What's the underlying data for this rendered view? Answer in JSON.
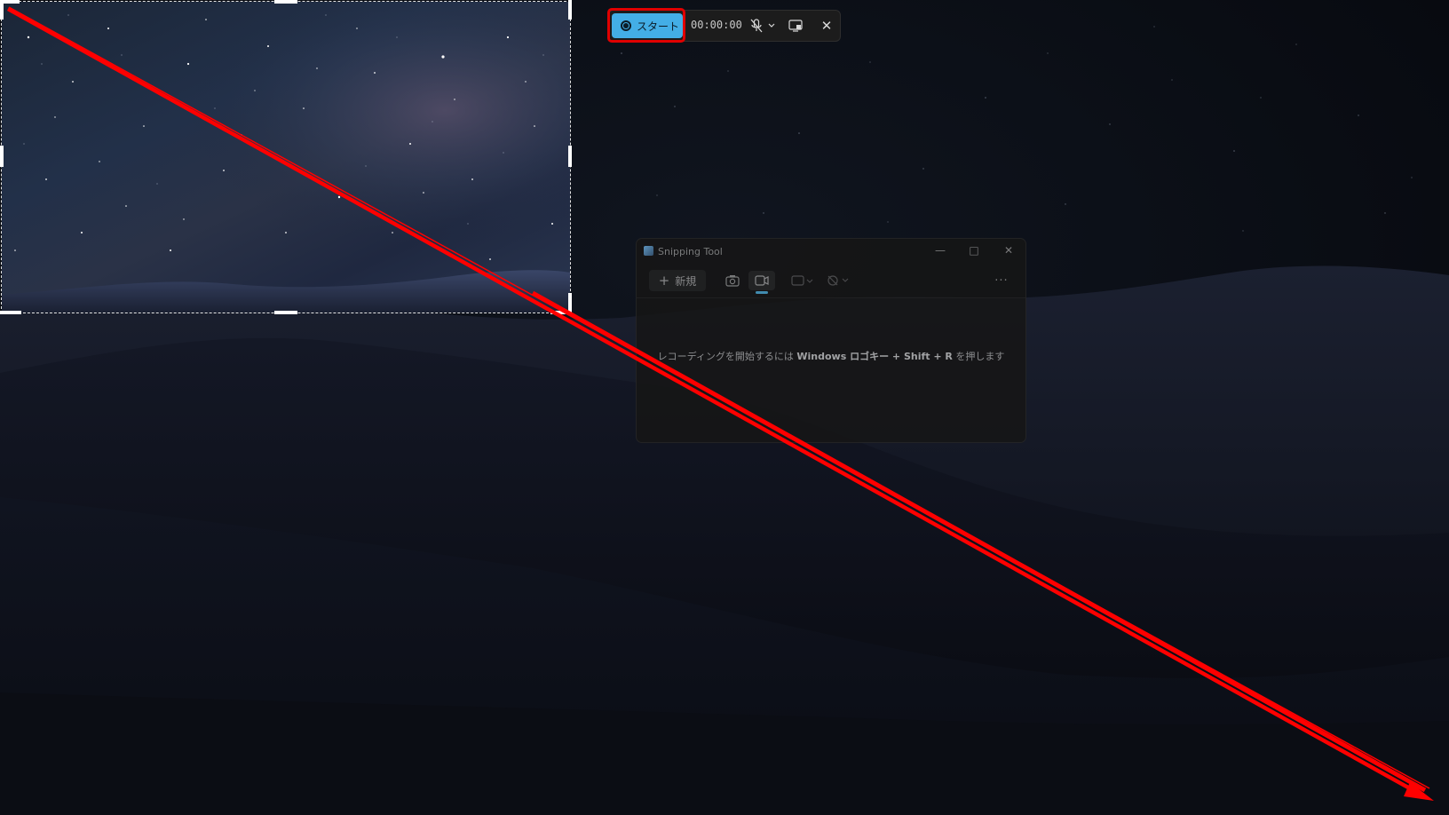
{
  "capture_bar": {
    "start_label": "スタート",
    "timer": "00:00:00",
    "mic_icon": "mic-off-icon",
    "dropdown_icon": "chevron-down-icon",
    "screen_icon": "screen-capture-icon",
    "close_icon": "close-icon"
  },
  "snipping_tool": {
    "title": "Snipping Tool",
    "new_label": "新規",
    "message_prefix": "レコーディングを開始するには ",
    "message_key": "Windows ロゴキー + Shift + R",
    "message_suffix": " を押します",
    "icons": [
      "camera-icon",
      "video-icon",
      "rectangle-mode-icon",
      "timer-off-icon",
      "more-icon"
    ]
  },
  "colors": {
    "start_button": "#43aee6",
    "highlight": "#e00000",
    "arrow": "#ff0000"
  }
}
